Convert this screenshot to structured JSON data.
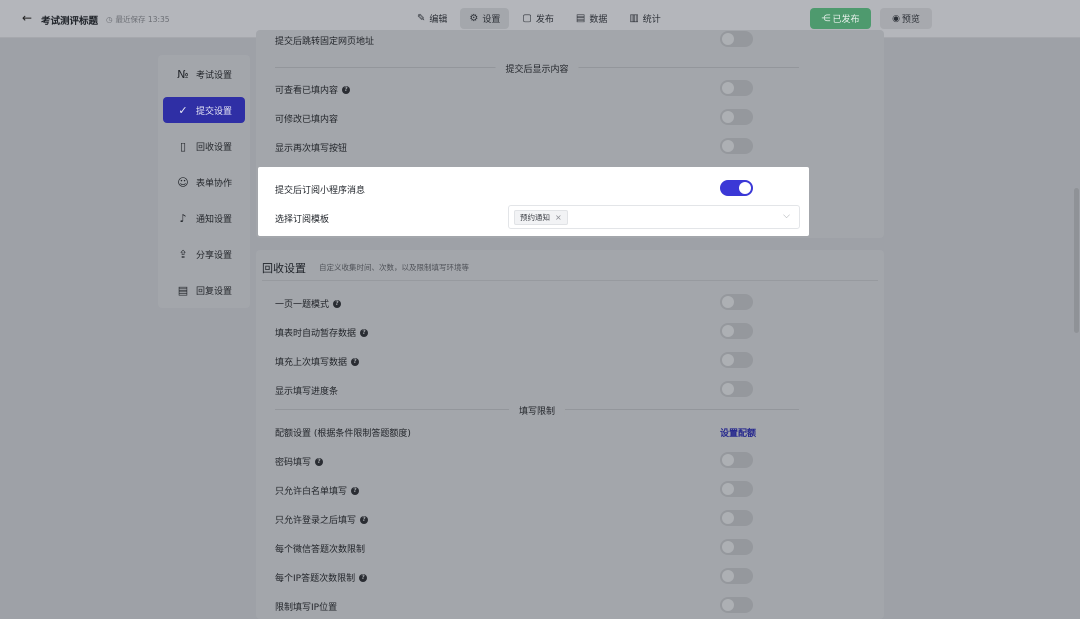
{
  "header": {
    "back_icon": "←",
    "title": "考试测评标题",
    "save_status": "最近保存 13:35",
    "tabs": [
      {
        "label": "编辑",
        "icon": "✎"
      },
      {
        "label": "设置",
        "icon": "⚙"
      },
      {
        "label": "发布",
        "icon": "▢"
      },
      {
        "label": "数据",
        "icon": "▤"
      },
      {
        "label": "统计",
        "icon": "▥"
      }
    ],
    "published_label": "已发布",
    "preview_label": "预览"
  },
  "sidebar": {
    "items": [
      {
        "label": "考试设置",
        "icon": "№"
      },
      {
        "label": "提交设置",
        "icon": "✓"
      },
      {
        "label": "回收设置",
        "icon": "▯"
      },
      {
        "label": "表单协作",
        "icon": "☺"
      },
      {
        "label": "通知设置",
        "icon": "♪"
      },
      {
        "label": "分享设置",
        "icon": "⇪"
      },
      {
        "label": "回复设置",
        "icon": "▤"
      }
    ]
  },
  "submit_section": {
    "redirect_label": "提交后跳转固定网页地址",
    "after_submit_divider": "提交后显示内容",
    "view_filled_label": "可查看已填内容",
    "edit_filled_label": "可修改已填内容",
    "show_refill_label": "显示再次填写按钮",
    "subscribe_label": "提交后订阅小程序消息",
    "subscribe_enabled": true,
    "template_label": "选择订阅模板",
    "template_tag": "预约通知"
  },
  "collect_section": {
    "title": "回收设置",
    "desc": "自定义收集时间、次数，以及限制填写环境等",
    "one_per_page": "一页一题模式",
    "auto_save": "填表时自动暂存数据",
    "fill_last": "填充上次填写数据",
    "progress_bar": "显示填写进度条",
    "limit_divider": "填写限制",
    "quota_label": "配额设置 (根据条件限制答题额度)",
    "quota_link": "设置配额",
    "password": "密码填写",
    "whitelist": "只允许白名单填写",
    "login_only": "只允许登录之后填写",
    "wechat_limit": "每个微信答题次数限制",
    "ip_limit": "每个IP答题次数限制",
    "ip_location": "限制填写IP位置"
  }
}
